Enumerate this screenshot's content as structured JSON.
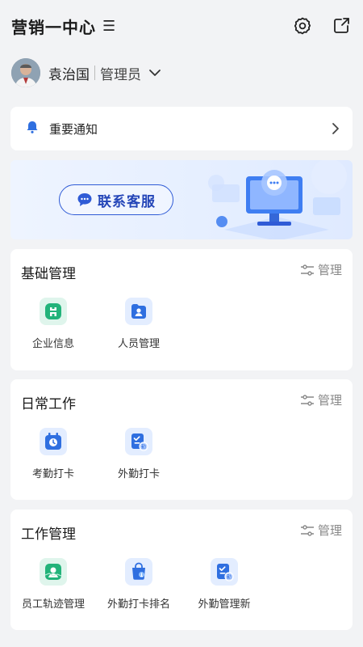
{
  "header": {
    "title": "营销一中心",
    "menu_glyph": "☰",
    "icons": [
      "gear-icon",
      "share-icon"
    ]
  },
  "user": {
    "name": "袁治国",
    "role": "管理员"
  },
  "notice": {
    "label": "重要通知"
  },
  "banner": {
    "button_label": "联系客服"
  },
  "sections": [
    {
      "title": "基础管理",
      "manage_label": "管理",
      "items": [
        {
          "label": "企业信息",
          "icon": "company-info-icon"
        },
        {
          "label": "人员管理",
          "icon": "personnel-icon"
        }
      ]
    },
    {
      "title": "日常工作",
      "manage_label": "管理",
      "items": [
        {
          "label": "考勤打卡",
          "icon": "clock-in-icon"
        },
        {
          "label": "外勤打卡",
          "icon": "field-clock-in-icon"
        }
      ]
    },
    {
      "title": "工作管理",
      "manage_label": "管理",
      "items": [
        {
          "label": "员工轨迹管理",
          "icon": "employee-track-icon"
        },
        {
          "label": "外勤打卡排名",
          "icon": "field-ranking-icon"
        },
        {
          "label": "外勤管理新",
          "icon": "field-management-icon"
        }
      ]
    }
  ],
  "colors": {
    "accent": "#2f6fe0",
    "green": "#22b37a",
    "brand_dark": "#2446b8",
    "background": "#f2f3f5"
  }
}
